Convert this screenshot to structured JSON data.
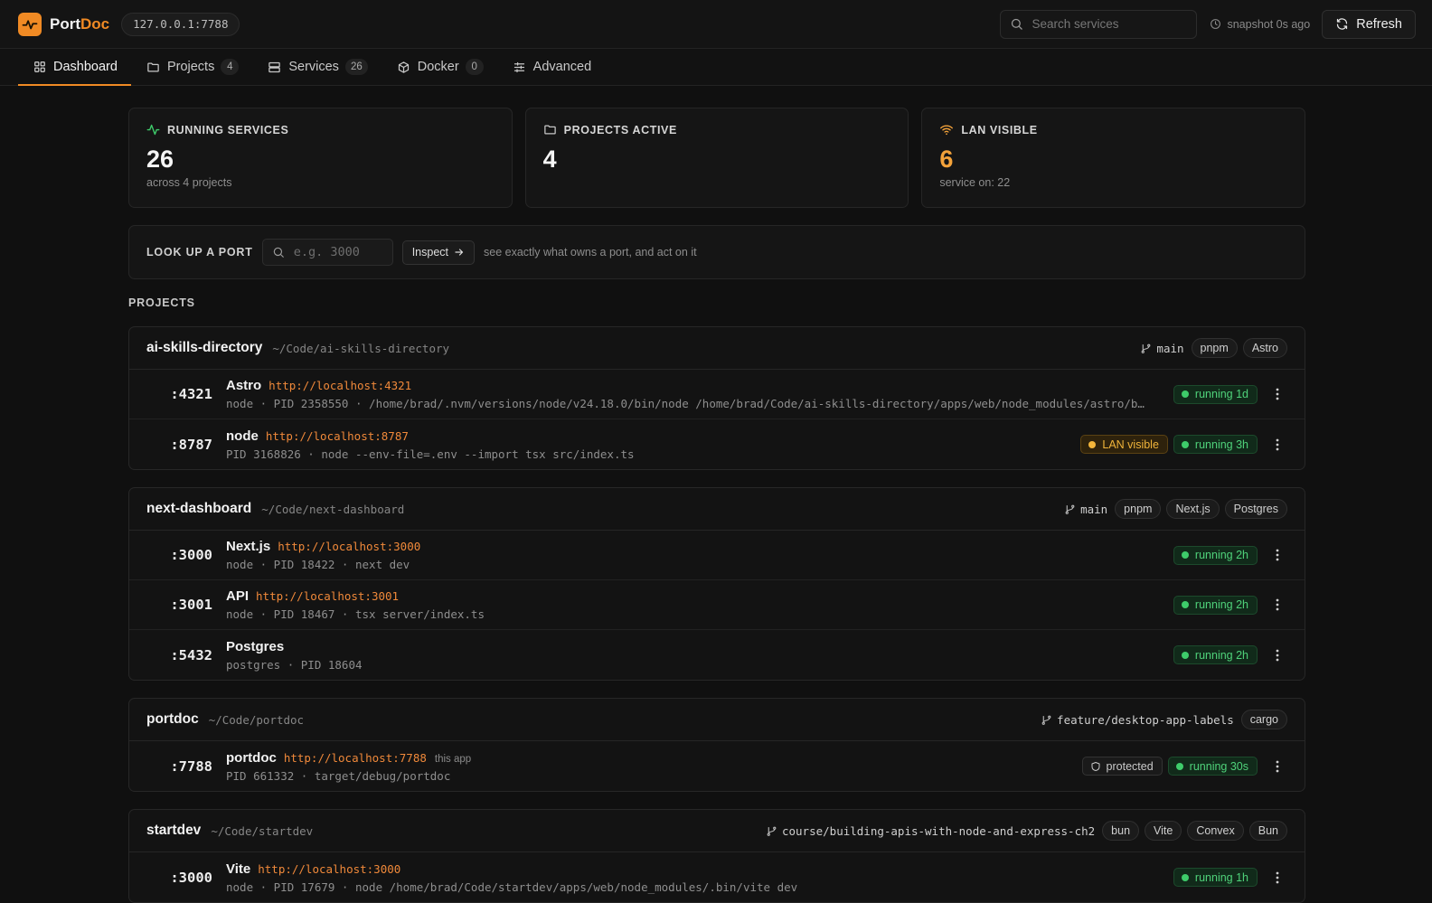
{
  "app": {
    "brand_port": "Port",
    "brand_doc": "Doc",
    "host": "127.0.0.1:7788"
  },
  "colors": {
    "accent": "#f08a24",
    "running": "#3ecb6a",
    "lan": "#f3b53b"
  },
  "search": {
    "placeholder": "Search services"
  },
  "snapshot": "snapshot 0s ago",
  "refresh_label": "Refresh",
  "tabs": [
    {
      "label": "Dashboard",
      "icon": "grid-icon"
    },
    {
      "label": "Projects",
      "count": "4",
      "icon": "folder-icon"
    },
    {
      "label": "Services",
      "count": "26",
      "icon": "server-icon"
    },
    {
      "label": "Docker",
      "count": "0",
      "icon": "box-icon"
    },
    {
      "label": "Advanced",
      "icon": "sliders-icon"
    }
  ],
  "stats": {
    "running": {
      "label": "RUNNING SERVICES",
      "value": "26",
      "sub": "across 4 projects"
    },
    "projects": {
      "label": "PROJECTS ACTIVE",
      "value": "4"
    },
    "lan": {
      "label": "LAN VISIBLE",
      "value": "6",
      "sub": "service on: 22"
    }
  },
  "lookup": {
    "label": "LOOK UP A PORT",
    "placeholder": "e.g. 3000",
    "button": "Inspect",
    "hint": "see exactly what owns a port, and act on it"
  },
  "section_title": "PROJECTS",
  "projects": [
    {
      "name": "ai-skills-directory",
      "path": "~/Code/ai-skills-directory",
      "branch": "main",
      "tags": [
        "pnpm",
        "Astro"
      ],
      "services": [
        {
          "port": ":4321",
          "name": "Astro",
          "url": "http://localhost:4321",
          "cmd": "node · PID 2358550 · /home/brad/.nvm/versions/node/v24.18.0/bin/node /home/brad/Code/ai-skills-directory/apps/web/node_modules/astro/b…",
          "status": "running 1d"
        },
        {
          "port": ":8787",
          "name": "node",
          "url": "http://localhost:8787",
          "cmd": "PID 3168826 · node --env-file=.env --import tsx src/index.ts",
          "lan": "LAN visible",
          "status": "running 3h"
        }
      ]
    },
    {
      "name": "next-dashboard",
      "path": "~/Code/next-dashboard",
      "branch": "main",
      "tags": [
        "pnpm",
        "Next.js",
        "Postgres"
      ],
      "services": [
        {
          "port": ":3000",
          "name": "Next.js",
          "url": "http://localhost:3000",
          "cmd": "node · PID 18422 · next dev",
          "status": "running 2h"
        },
        {
          "port": ":3001",
          "name": "API",
          "url": "http://localhost:3001",
          "cmd": "node · PID 18467 · tsx server/index.ts",
          "status": "running 2h"
        },
        {
          "port": ":5432",
          "name": "Postgres",
          "cmd": "postgres · PID 18604",
          "status": "running 2h"
        }
      ]
    },
    {
      "name": "portdoc",
      "path": "~/Code/portdoc",
      "branch": "feature/desktop-app-labels",
      "tags": [
        "cargo"
      ],
      "services": [
        {
          "port": ":7788",
          "name": "portdoc",
          "url": "http://localhost:7788",
          "note": "this app",
          "cmd": "PID 661332 · target/debug/portdoc",
          "protected": "protected",
          "status": "running 30s"
        }
      ]
    },
    {
      "name": "startdev",
      "path": "~/Code/startdev",
      "branch": "course/building-apis-with-node-and-express-ch2",
      "tags": [
        "bun",
        "Vite",
        "Convex",
        "Bun"
      ],
      "services": [
        {
          "port": ":3000",
          "name": "Vite",
          "url": "http://localhost:3000",
          "cmd": "node · PID 17679 · node /home/brad/Code/startdev/apps/web/node_modules/.bin/vite dev",
          "status": "running 1h"
        }
      ]
    }
  ]
}
